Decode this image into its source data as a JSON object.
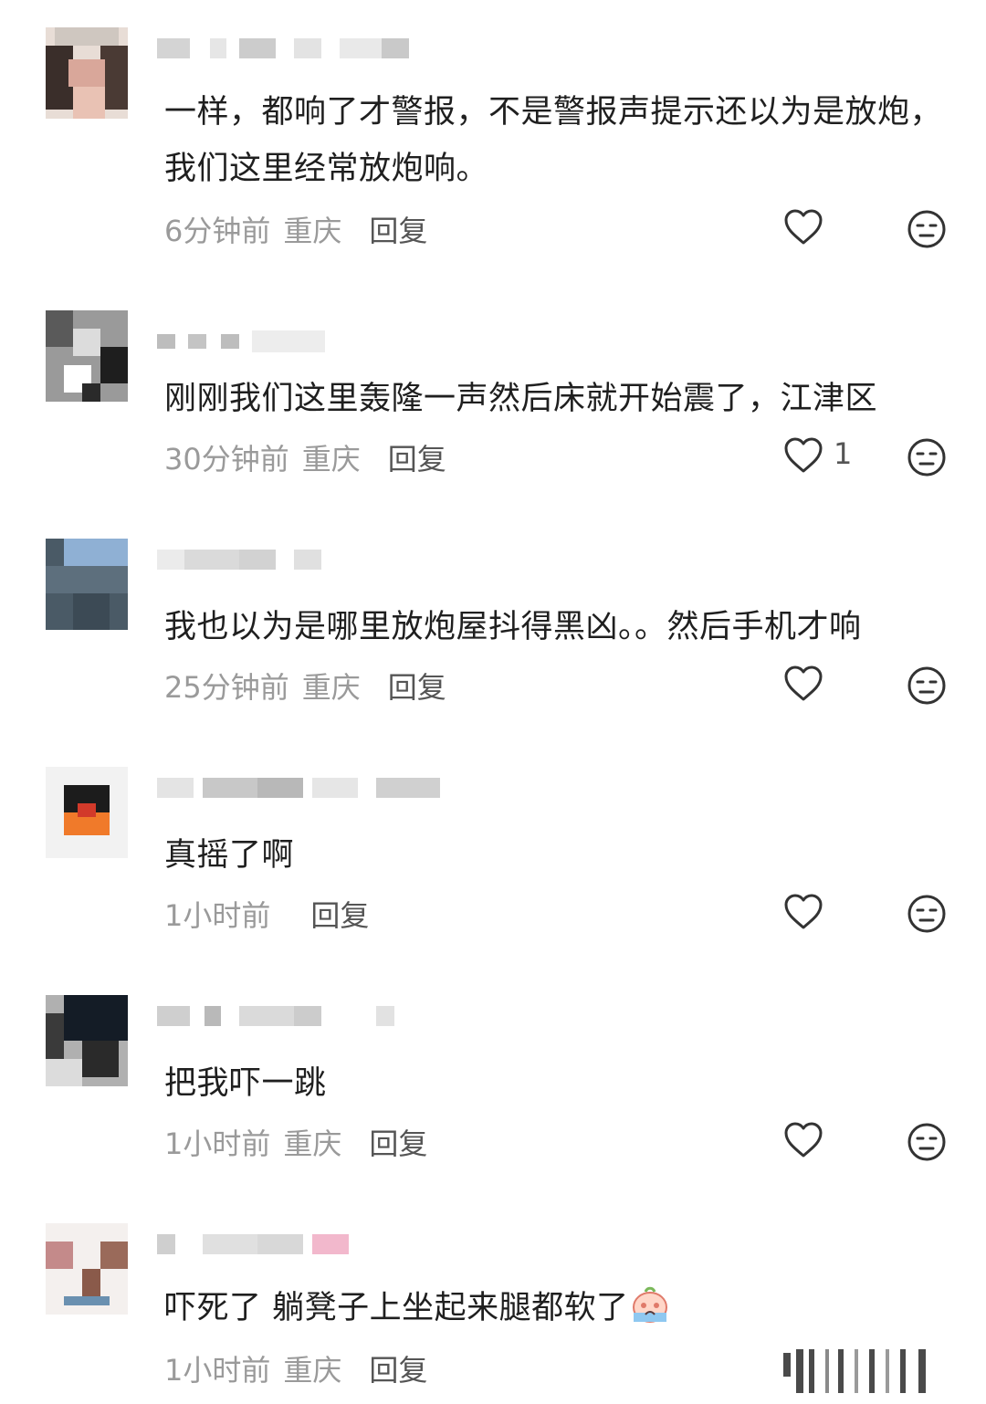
{
  "comments": [
    {
      "text": "一样，都响了才警报，不是警报声提示还以为是放炮，我们这里经常放炮响。",
      "time": "6分钟前",
      "location": "重庆",
      "reply": "回复",
      "likes": ""
    },
    {
      "text": "刚刚我们这里轰隆一声然后床就开始震了，江津区",
      "time": "30分钟前",
      "location": "重庆",
      "reply": "回复",
      "likes": "1"
    },
    {
      "text": "我也以为是哪里放炮屋抖得黑凶。。然后手机才响",
      "time": "25分钟前",
      "location": "重庆",
      "reply": "回复",
      "likes": ""
    },
    {
      "text": "真摇了啊",
      "time": "1小时前",
      "location": "",
      "reply": "回复",
      "likes": ""
    },
    {
      "text": "把我吓一跳",
      "time": "1小时前",
      "location": "重庆",
      "reply": "回复",
      "likes": ""
    },
    {
      "text": "吓死了 躺凳子上坐起来腿都软了",
      "time": "1小时前",
      "location": "重庆",
      "reply": "回复",
      "likes": ""
    }
  ],
  "icons": {
    "like": "heart-outline-icon",
    "dislike": "neutral-face-icon",
    "emoji": "crying-face-emoji"
  },
  "colors": {
    "text": "#1f1f1f",
    "meta": "#9a9a9a",
    "icon": "#333333"
  }
}
